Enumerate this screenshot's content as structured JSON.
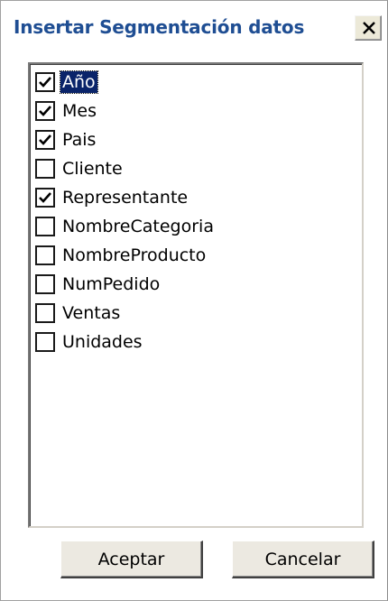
{
  "dialog": {
    "title": "Insertar Segmentación datos",
    "close_label": "X",
    "fields": [
      {
        "label": "Año",
        "checked": true,
        "selected": true
      },
      {
        "label": "Mes",
        "checked": true,
        "selected": false
      },
      {
        "label": "Pais",
        "checked": true,
        "selected": false
      },
      {
        "label": "Cliente",
        "checked": false,
        "selected": false
      },
      {
        "label": "Representante",
        "checked": true,
        "selected": false
      },
      {
        "label": "NombreCategoria",
        "checked": false,
        "selected": false
      },
      {
        "label": "NombreProducto",
        "checked": false,
        "selected": false
      },
      {
        "label": "NumPedido",
        "checked": false,
        "selected": false
      },
      {
        "label": "Ventas",
        "checked": false,
        "selected": false
      },
      {
        "label": "Unidades",
        "checked": false,
        "selected": false
      }
    ],
    "ok_label": "Aceptar",
    "cancel_label": "Cancelar"
  },
  "colors": {
    "title": "#1f4e93",
    "selection": "#0a246a"
  }
}
